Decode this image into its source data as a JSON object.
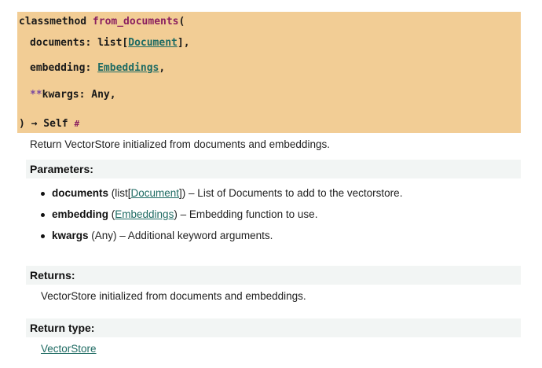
{
  "signature": {
    "keyword": "classmethod",
    "name": "from_documents",
    "open_paren": "(",
    "p1_name": "documents",
    "p1_sep": ": ",
    "p1_type_pre": "list[",
    "p1_type_link": "Document",
    "p1_type_post": "],",
    "p2_name": "embedding",
    "p2_sep": ": ",
    "p2_type_link": "Embeddings",
    "p2_post": ",",
    "p3_stars": "**",
    "p3_name": "kwargs",
    "p3_sep": ": ",
    "p3_type": "Any,",
    "close": ") → Self",
    "anchor": "#"
  },
  "description": "Return VectorStore initialized from documents and embeddings.",
  "parameters": {
    "heading": "Parameters:",
    "items": [
      {
        "name": "documents",
        "type_pre": " (list[",
        "type_link": "Document",
        "type_post": "])",
        "desc": " – List of Documents to add to the vectorstore."
      },
      {
        "name": "embedding",
        "type_pre": " (",
        "type_link": "Embeddings",
        "type_post": ")",
        "desc": " – Embedding function to use."
      },
      {
        "name": "kwargs",
        "type_pre": " (Any)",
        "type_link": "",
        "type_post": "",
        "desc": " – Additional keyword arguments."
      }
    ]
  },
  "returns": {
    "heading": "Returns:",
    "text": "VectorStore initialized from documents and embeddings."
  },
  "return_type": {
    "heading": "Return type:",
    "link": "VectorStore"
  }
}
